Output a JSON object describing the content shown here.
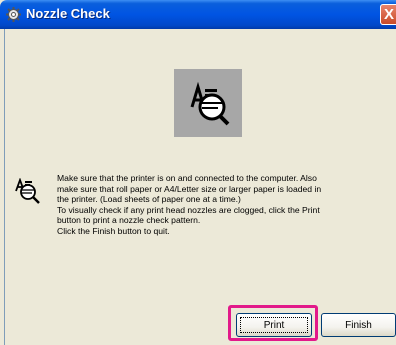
{
  "window": {
    "title": "Nozzle Check",
    "close_symbol": "X"
  },
  "icons": {
    "title_icon": "gear-icon",
    "main_icon": "nozzle-check-magnifier-icon",
    "message_icon": "nozzle-check-magnifier-icon"
  },
  "message": {
    "lines": [
      "Make sure that the printer is on and connected to the computer. Also",
      "make sure that roll paper or A4/Letter size or larger paper is loaded in",
      "the printer. (Load sheets of paper one at a time.)",
      "To visually check if any print head nozzles are clogged, click the Print",
      "button to print a nozzle check pattern.",
      "Click the Finish button to quit."
    ]
  },
  "buttons": {
    "print": "Print",
    "finish": "Finish"
  },
  "colors": {
    "titlebar": "#0054e3",
    "window_bg": "#ece9d8",
    "highlight": "#e2198a",
    "icon_bg": "#a7a7a7"
  }
}
